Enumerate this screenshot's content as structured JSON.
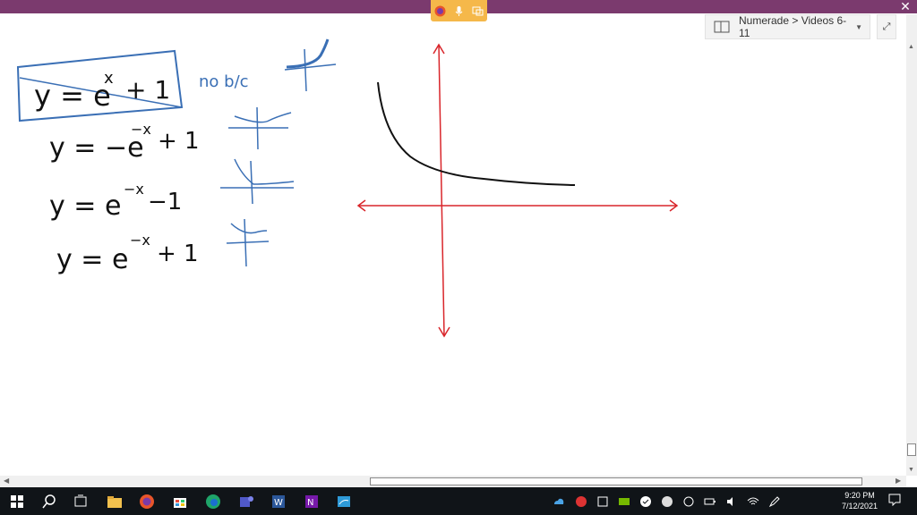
{
  "window": {
    "close_glyph": "✕",
    "app_icons": [
      "firefox-icon",
      "microphone-icon",
      "snip-icon"
    ]
  },
  "header": {
    "breadcrumb": "Numerade > Videos 6-11",
    "breadcrumb_chevron": "▼",
    "expand_glyph": "⤢"
  },
  "scrollbars": {
    "up": "▲",
    "down": "▼",
    "left": "◀",
    "right": "▶"
  },
  "notes": {
    "eq1": "y = e",
    "eq1_exp": "x",
    "eq1_tail": "+ 1",
    "eq1_note": "no b/c",
    "eq2": "y = −e",
    "eq2_exp": "−x",
    "eq2_tail": "+ 1",
    "eq3": "y = e",
    "eq3_exp": "−x",
    "eq3_tail": "−1",
    "eq4": "y = e",
    "eq4_exp": "−x",
    "eq4_tail": "+ 1"
  },
  "colors": {
    "titlebar": "#7b3a6e",
    "ink_black": "#111111",
    "ink_blue": "#3a6fb5",
    "axis_red": "#d9262b",
    "taskbar": "#101418"
  },
  "taskbar": {
    "apps": [
      "windows-start-icon",
      "search-icon",
      "task-view-icon",
      "file-explorer-icon",
      "firefox-icon",
      "store-icon",
      "edge-icon",
      "teams-icon",
      "word-icon",
      "onenote-icon",
      "whiteboard-icon"
    ],
    "tray": [
      "onedrive-icon",
      "tray-app-icon",
      "snip-tray-icon",
      "nvidia-icon",
      "tray-check-icon",
      "tray-app2-icon",
      "refresh-icon",
      "battery-icon",
      "volume-icon",
      "wifi-icon",
      "pen-icon"
    ],
    "time": "9:20 PM",
    "date": "7/12/2021"
  }
}
